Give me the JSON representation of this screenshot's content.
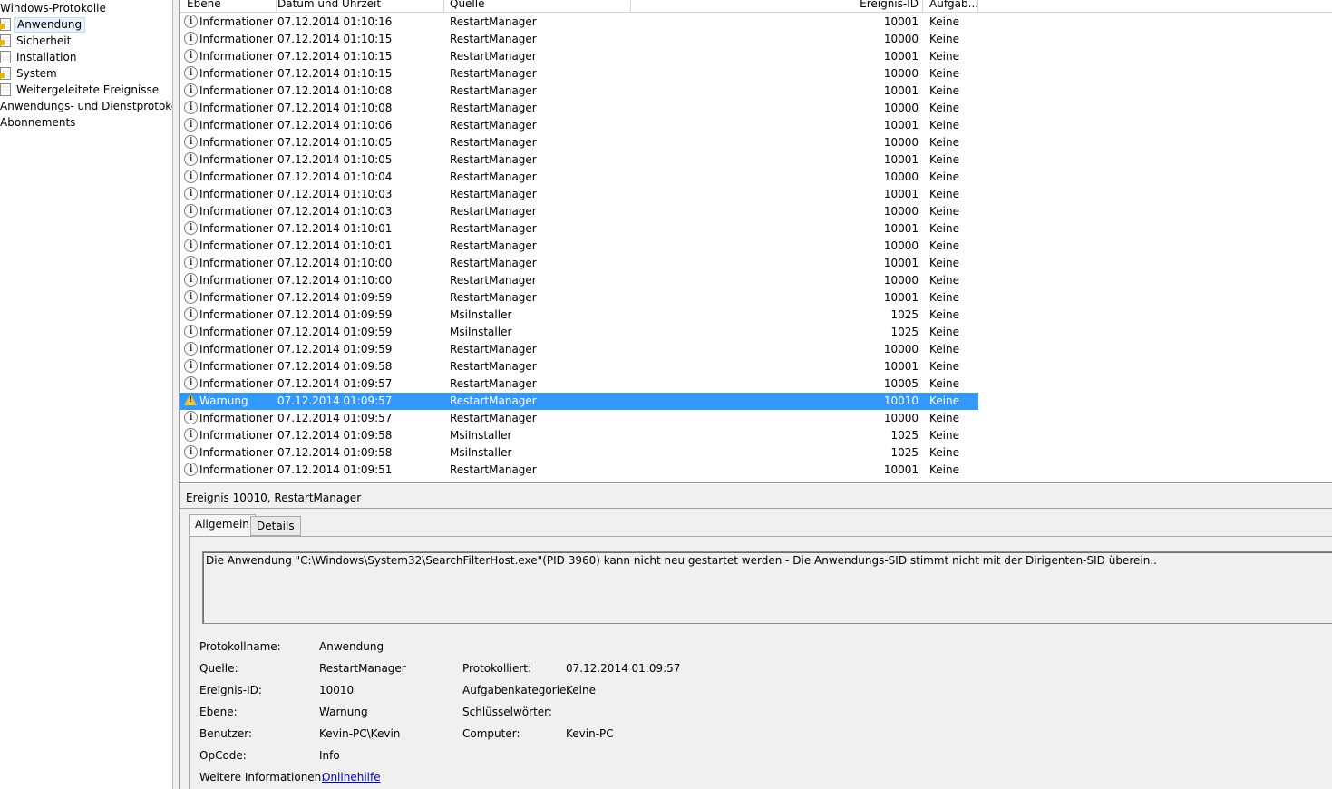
{
  "tree": {
    "items": [
      {
        "label": "Windows-Protokolle",
        "icon": "none"
      },
      {
        "label": "Anwendung",
        "icon": "log-alert-icon",
        "selected": true
      },
      {
        "label": "Sicherheit",
        "icon": "log-alert-icon"
      },
      {
        "label": "Installation",
        "icon": "log-icon"
      },
      {
        "label": "System",
        "icon": "log-alert-icon"
      },
      {
        "label": "Weitergeleitete Ereignisse",
        "icon": "log-icon"
      },
      {
        "label": "Anwendungs- und Dienstprotokolle",
        "icon": "none"
      },
      {
        "label": "Abonnements",
        "icon": "none"
      }
    ]
  },
  "grid": {
    "columns": {
      "level": "Ebene",
      "date": "Datum und Uhrzeit",
      "source": "Quelle",
      "event_id": "Ereignis-ID",
      "task": "Aufgab..."
    },
    "rows": [
      {
        "level": "Informationen",
        "date": "07.12.2014 01:10:16",
        "source": "RestartManager",
        "id": "10001",
        "task": "Keine"
      },
      {
        "level": "Informationen",
        "date": "07.12.2014 01:10:15",
        "source": "RestartManager",
        "id": "10000",
        "task": "Keine"
      },
      {
        "level": "Informationen",
        "date": "07.12.2014 01:10:15",
        "source": "RestartManager",
        "id": "10001",
        "task": "Keine"
      },
      {
        "level": "Informationen",
        "date": "07.12.2014 01:10:15",
        "source": "RestartManager",
        "id": "10000",
        "task": "Keine"
      },
      {
        "level": "Informationen",
        "date": "07.12.2014 01:10:08",
        "source": "RestartManager",
        "id": "10001",
        "task": "Keine"
      },
      {
        "level": "Informationen",
        "date": "07.12.2014 01:10:08",
        "source": "RestartManager",
        "id": "10000",
        "task": "Keine"
      },
      {
        "level": "Informationen",
        "date": "07.12.2014 01:10:06",
        "source": "RestartManager",
        "id": "10001",
        "task": "Keine"
      },
      {
        "level": "Informationen",
        "date": "07.12.2014 01:10:05",
        "source": "RestartManager",
        "id": "10000",
        "task": "Keine"
      },
      {
        "level": "Informationen",
        "date": "07.12.2014 01:10:05",
        "source": "RestartManager",
        "id": "10001",
        "task": "Keine"
      },
      {
        "level": "Informationen",
        "date": "07.12.2014 01:10:04",
        "source": "RestartManager",
        "id": "10000",
        "task": "Keine"
      },
      {
        "level": "Informationen",
        "date": "07.12.2014 01:10:03",
        "source": "RestartManager",
        "id": "10001",
        "task": "Keine"
      },
      {
        "level": "Informationen",
        "date": "07.12.2014 01:10:03",
        "source": "RestartManager",
        "id": "10000",
        "task": "Keine"
      },
      {
        "level": "Informationen",
        "date": "07.12.2014 01:10:01",
        "source": "RestartManager",
        "id": "10001",
        "task": "Keine"
      },
      {
        "level": "Informationen",
        "date": "07.12.2014 01:10:01",
        "source": "RestartManager",
        "id": "10000",
        "task": "Keine"
      },
      {
        "level": "Informationen",
        "date": "07.12.2014 01:10:00",
        "source": "RestartManager",
        "id": "10001",
        "task": "Keine"
      },
      {
        "level": "Informationen",
        "date": "07.12.2014 01:10:00",
        "source": "RestartManager",
        "id": "10000",
        "task": "Keine"
      },
      {
        "level": "Informationen",
        "date": "07.12.2014 01:09:59",
        "source": "RestartManager",
        "id": "10001",
        "task": "Keine"
      },
      {
        "level": "Informationen",
        "date": "07.12.2014 01:09:59",
        "source": "MsiInstaller",
        "id": "1025",
        "task": "Keine"
      },
      {
        "level": "Informationen",
        "date": "07.12.2014 01:09:59",
        "source": "MsiInstaller",
        "id": "1025",
        "task": "Keine"
      },
      {
        "level": "Informationen",
        "date": "07.12.2014 01:09:59",
        "source": "RestartManager",
        "id": "10000",
        "task": "Keine"
      },
      {
        "level": "Informationen",
        "date": "07.12.2014 01:09:58",
        "source": "RestartManager",
        "id": "10001",
        "task": "Keine"
      },
      {
        "level": "Informationen",
        "date": "07.12.2014 01:09:57",
        "source": "RestartManager",
        "id": "10005",
        "task": "Keine"
      },
      {
        "level": "Warnung",
        "date": "07.12.2014 01:09:57",
        "source": "RestartManager",
        "id": "10010",
        "task": "Keine",
        "selected": true
      },
      {
        "level": "Informationen",
        "date": "07.12.2014 01:09:57",
        "source": "RestartManager",
        "id": "10000",
        "task": "Keine"
      },
      {
        "level": "Informationen",
        "date": "07.12.2014 01:09:58",
        "source": "MsiInstaller",
        "id": "1025",
        "task": "Keine"
      },
      {
        "level": "Informationen",
        "date": "07.12.2014 01:09:58",
        "source": "MsiInstaller",
        "id": "1025",
        "task": "Keine"
      },
      {
        "level": "Informationen",
        "date": "07.12.2014 01:09:51",
        "source": "RestartManager",
        "id": "10001",
        "task": "Keine"
      }
    ],
    "selection_color": "#3399ff"
  },
  "detail": {
    "title": "Ereignis 10010, RestartManager",
    "tabs": [
      "Allgemein",
      "Details"
    ],
    "message": "Die Anwendung \"C:\\Windows\\System32\\SearchFilterHost.exe\"(PID 3960) kann  nicht neu gestartet werden - Die Anwendungs-SID stimmt nicht mit der Dirigenten-SID überein..",
    "props": {
      "log_name_label": "Protokollname:",
      "log_name": "Anwendung",
      "source_label": "Quelle:",
      "source": "RestartManager",
      "logged_label": "Protokolliert:",
      "logged": "07.12.2014 01:09:57",
      "event_id_label": "Ereignis-ID:",
      "event_id": "10010",
      "task_cat_label": "Aufgabenkategorie:",
      "task_cat": "Keine",
      "level_label": "Ebene:",
      "level": "Warnung",
      "keywords_label": "Schlüsselwörter:",
      "keywords": "",
      "user_label": "Benutzer:",
      "user": "Kevin-PC\\Kevin",
      "computer_label": "Computer:",
      "computer": "Kevin-PC",
      "opcode_label": "OpCode:",
      "opcode": "Info",
      "more_info_label": "Weitere Informationen:",
      "more_info_link": "Onlinehilfe"
    }
  }
}
